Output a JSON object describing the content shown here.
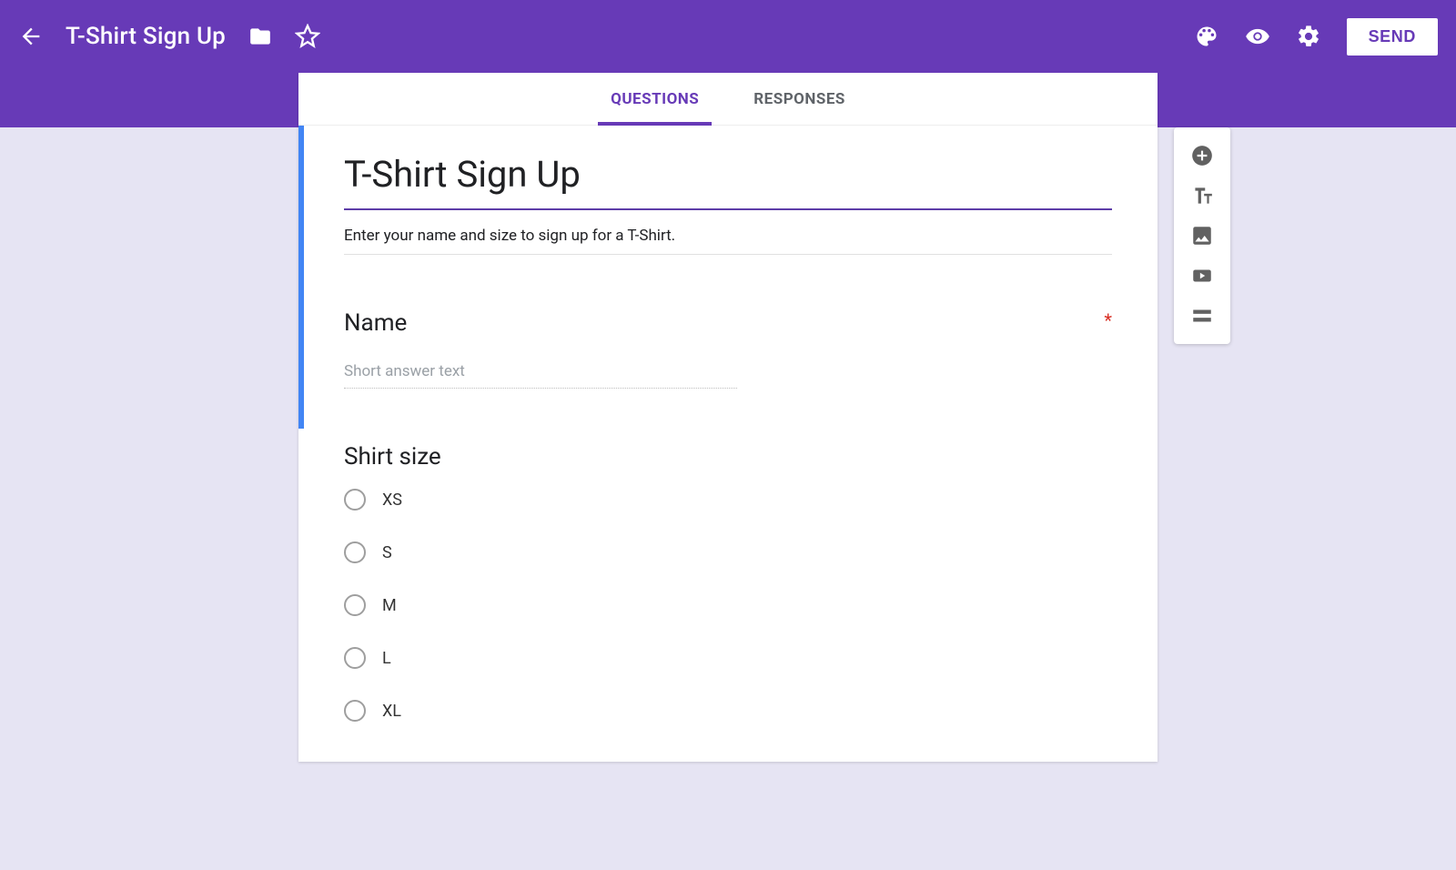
{
  "header": {
    "title": "T-Shirt Sign Up",
    "send_label": "SEND"
  },
  "tabs": {
    "questions": "QUESTIONS",
    "responses": "RESPONSES"
  },
  "form": {
    "title": "T-Shirt Sign Up",
    "description": "Enter your name and size to sign up for a T-Shirt."
  },
  "q1": {
    "title": "Name",
    "placeholder": "Short answer text",
    "required_marker": "*"
  },
  "q2": {
    "title": "Shirt size",
    "options": [
      "XS",
      "S",
      "M",
      "L",
      "XL"
    ]
  }
}
